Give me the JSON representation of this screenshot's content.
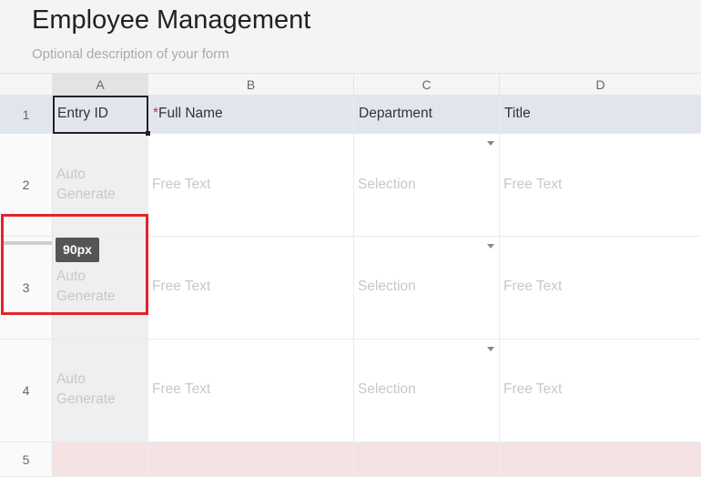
{
  "form": {
    "title": "Employee Management",
    "description": "Optional description of your form"
  },
  "columns": [
    {
      "letter": "A",
      "label": "Entry ID",
      "required": false
    },
    {
      "letter": "B",
      "label": "Full Name",
      "required": true
    },
    {
      "letter": "C",
      "label": "Department",
      "required": false
    },
    {
      "letter": "D",
      "label": "Title",
      "required": false
    }
  ],
  "required_marker": "*",
  "rows": [
    {
      "num": "1"
    },
    {
      "num": "2",
      "cells": [
        "Auto Generate",
        "Free Text",
        "Selection",
        "Free Text"
      ]
    },
    {
      "num": "3",
      "cells": [
        "Auto Generate",
        "Free Text",
        "Selection",
        "Free Text"
      ]
    },
    {
      "num": "4",
      "cells": [
        "Auto Generate",
        "Free Text",
        "Selection",
        "Free Text"
      ]
    },
    {
      "num": "5"
    }
  ],
  "resize_tooltip": "90px",
  "colors": {
    "header_row": "#e1e6ee",
    "required": "#e0282e",
    "highlight": "#e2252b",
    "row5": "#f5e3e3"
  }
}
